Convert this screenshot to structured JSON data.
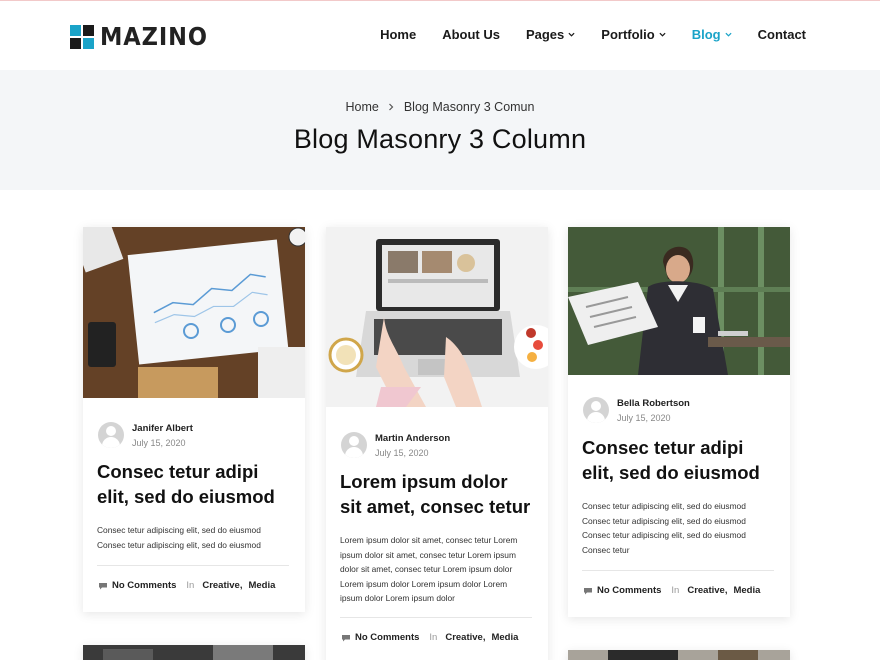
{
  "brand": {
    "name": "MAZINO"
  },
  "nav": {
    "items": [
      {
        "label": "Home",
        "dropdown": false
      },
      {
        "label": "About Us",
        "dropdown": false
      },
      {
        "label": "Pages",
        "dropdown": true
      },
      {
        "label": "Portfolio",
        "dropdown": true
      },
      {
        "label": "Blog",
        "dropdown": true,
        "active": true
      },
      {
        "label": "Contact",
        "dropdown": false
      }
    ]
  },
  "page_header": {
    "breadcrumb": [
      "Home",
      "Blog Masonry 3 Comun"
    ],
    "title": "Blog Masonry 3 Column"
  },
  "posts": [
    {
      "author": "Janifer Albert",
      "date": "July 15, 2020",
      "title_lines": [
        "Consec tetur adipi",
        "elit, sed do eiusmod"
      ],
      "excerpt_lines": [
        "Consec tetur adipiscing elit, sed do eiusmod",
        "Consec tetur adipiscing elit, sed do eiusmod"
      ],
      "comments": "No Comments",
      "in": "In",
      "categories": [
        "Creative,",
        "Media"
      ]
    },
    {
      "author": "Martin Anderson",
      "date": "July 15, 2020",
      "title_lines": [
        "Lorem ipsum dolor",
        "sit amet, consec tetur"
      ],
      "excerpt_lines": [
        "Lorem ipsum dolor sit amet, consec tetur Lorem",
        "ipsum dolor sit amet, consec tetur Lorem ipsum",
        "dolor sit amet, consec tetur Lorem ipsum dolor",
        "Lorem ipsum dolor Lorem ipsum dolor Lorem",
        "ipsum dolor Lorem ipsum dolor"
      ],
      "comments": "No Comments",
      "in": "In",
      "categories": [
        "Creative,",
        "Media"
      ]
    },
    {
      "author": "Bella Robertson",
      "date": "July 15, 2020",
      "title_lines": [
        "Consec tetur adipi",
        "elit, sed do eiusmod"
      ],
      "excerpt_lines": [
        "Consec tetur adipiscing elit, sed do eiusmod",
        "Consec tetur adipiscing elit, sed do eiusmod",
        "Consec tetur adipiscing elit, sed do eiusmod",
        "Consec tetur"
      ],
      "comments": "No Comments",
      "in": "In",
      "categories": [
        "Creative,",
        "Media"
      ]
    }
  ],
  "colors": {
    "accent": "#1aa3c8",
    "band": "#f4f6f8"
  }
}
